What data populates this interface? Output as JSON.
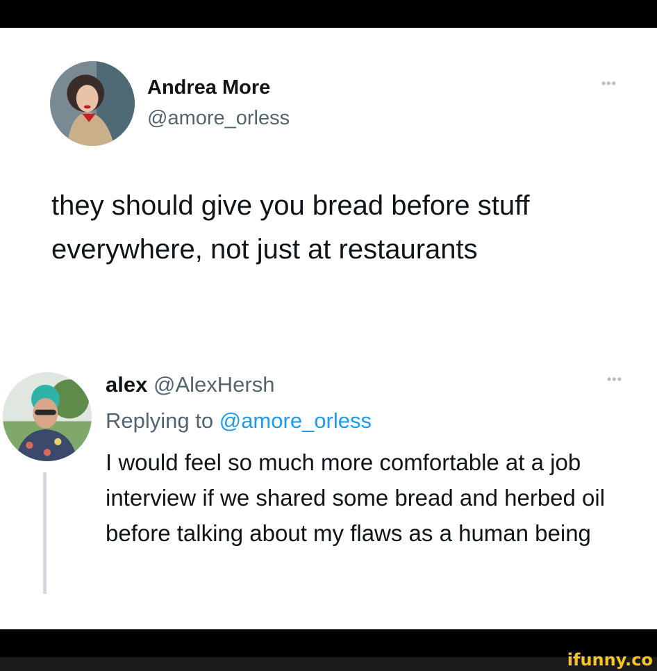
{
  "tweet": {
    "author_name": "Andrea More",
    "author_handle": "@amore_orless",
    "more_glyph": "•••",
    "text": "they should give you bread before stuff everywhere, not just at restaurants"
  },
  "reply": {
    "author_name": "alex",
    "author_handle": "@AlexHersh",
    "more_glyph": "•••",
    "replying_label": "Replying to",
    "replying_to": "@amore_orless",
    "text": "I would feel so much more comfortable at a job interview if we shared some bread and herbed oil before talking about my flaws as a human being"
  },
  "watermark": "ifunny.co",
  "colors": {
    "text_primary": "#0f1419",
    "text_secondary": "#536471",
    "link": "#1d9bf0",
    "thread_line": "#cfd9de",
    "watermark": "#f5c623"
  },
  "icons": {
    "more": "more-options-icon",
    "avatar1": "profile-photo",
    "avatar2": "profile-photo"
  }
}
